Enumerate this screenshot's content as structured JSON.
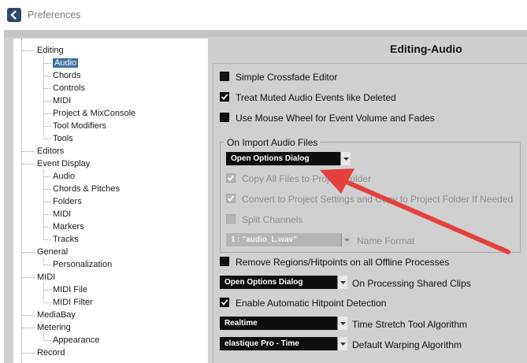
{
  "window": {
    "title": "Preferences"
  },
  "tree": {
    "items": [
      {
        "label": "Editing",
        "level": 0,
        "selected": false,
        "name": "tree-item-editing"
      },
      {
        "label": "Audio",
        "level": 1,
        "selected": true,
        "name": "tree-item-editing-audio"
      },
      {
        "label": "Chords",
        "level": 1,
        "selected": false,
        "name": "tree-item-editing-chords"
      },
      {
        "label": "Controls",
        "level": 1,
        "selected": false,
        "name": "tree-item-editing-controls"
      },
      {
        "label": "MIDI",
        "level": 1,
        "selected": false,
        "name": "tree-item-editing-midi"
      },
      {
        "label": "Project & MixConsole",
        "level": 1,
        "selected": false,
        "name": "tree-item-project-mixconsole"
      },
      {
        "label": "Tool Modifiers",
        "level": 1,
        "selected": false,
        "name": "tree-item-tool-modifiers"
      },
      {
        "label": "Tools",
        "level": 1,
        "selected": false,
        "name": "tree-item-tools"
      },
      {
        "label": "Editors",
        "level": 0,
        "selected": false,
        "name": "tree-item-editors"
      },
      {
        "label": "Event Display",
        "level": 0,
        "selected": false,
        "name": "tree-item-event-display"
      },
      {
        "label": "Audio",
        "level": 1,
        "selected": false,
        "name": "tree-item-event-display-audio"
      },
      {
        "label": "Chords & Pitches",
        "level": 1,
        "selected": false,
        "name": "tree-item-chords-pitches"
      },
      {
        "label": "Folders",
        "level": 1,
        "selected": false,
        "name": "tree-item-folders"
      },
      {
        "label": "MIDI",
        "level": 1,
        "selected": false,
        "name": "tree-item-event-display-midi"
      },
      {
        "label": "Markers",
        "level": 1,
        "selected": false,
        "name": "tree-item-markers"
      },
      {
        "label": "Tracks",
        "level": 1,
        "selected": false,
        "name": "tree-item-tracks"
      },
      {
        "label": "General",
        "level": 0,
        "selected": false,
        "name": "tree-item-general"
      },
      {
        "label": "Personalization",
        "level": 1,
        "selected": false,
        "name": "tree-item-personalization"
      },
      {
        "label": "MIDI",
        "level": 0,
        "selected": false,
        "name": "tree-item-midi"
      },
      {
        "label": "MIDI File",
        "level": 1,
        "selected": false,
        "name": "tree-item-midi-file"
      },
      {
        "label": "MIDI Filter",
        "level": 1,
        "selected": false,
        "name": "tree-item-midi-filter"
      },
      {
        "label": "MediaBay",
        "level": 0,
        "selected": false,
        "name": "tree-item-mediabay"
      },
      {
        "label": "Metering",
        "level": 0,
        "selected": false,
        "name": "tree-item-metering"
      },
      {
        "label": "Appearance",
        "level": 1,
        "selected": false,
        "name": "tree-item-appearance"
      },
      {
        "label": "Record",
        "level": 0,
        "selected": false,
        "name": "tree-item-record"
      }
    ]
  },
  "panel": {
    "title": "Editing-Audio",
    "options": {
      "simple_crossfade": {
        "label": "Simple Crossfade Editor",
        "checked": false
      },
      "treat_muted": {
        "label": "Treat Muted Audio Events like Deleted",
        "checked": true
      },
      "mouse_wheel": {
        "label": "Use Mouse Wheel for Event Volume and Fades",
        "checked": false
      }
    },
    "import_group": {
      "title": "On Import Audio Files",
      "mode_value": "Open Options Dialog",
      "copy_files": {
        "label": "Copy All Files to Project Folder",
        "checked": true
      },
      "convert_settings": {
        "label": "Convert to Project Settings and Copy to Project Folder If Needed",
        "checked": true
      },
      "split_channels": {
        "label": "Split Channels",
        "checked": false
      },
      "name_format_value": "1 : \"audio_L.wav\"",
      "name_format_label": "Name Format"
    },
    "remove_regions": {
      "label": "Remove Regions/Hitpoints on all Offline Processes",
      "checked": false
    },
    "shared_clips": {
      "value": "Open Options Dialog",
      "label": "On Processing Shared Clips"
    },
    "hitpoint_detection": {
      "label": "Enable Automatic Hitpoint Detection",
      "checked": true
    },
    "time_stretch": {
      "value": "Realtime",
      "label": "Time Stretch Tool Algorithm"
    },
    "warping": {
      "value": "elastique Pro - Time",
      "label": "Default Warping Algorithm"
    }
  },
  "annotation": {
    "color": "#e5403d"
  }
}
